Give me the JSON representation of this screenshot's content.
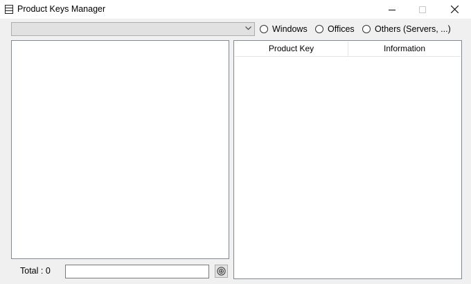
{
  "window": {
    "title": "Product Keys Manager",
    "icons": {
      "app": "list-window-icon",
      "minimize": "minimize-icon",
      "maximize": "maximize-icon",
      "close": "close-icon"
    }
  },
  "filter": {
    "combo_value": "",
    "combo_icon": "chevron-down-icon",
    "radios": [
      {
        "label": "Windows",
        "checked": false
      },
      {
        "label": "Offices",
        "checked": false
      },
      {
        "label": "Others (Servers, ...)",
        "checked": false
      }
    ]
  },
  "table": {
    "columns": [
      "Product Key",
      "Information"
    ],
    "rows": []
  },
  "footer": {
    "total_label": "Total : 0",
    "input_value": "",
    "add_icon": "circle-plus-icon"
  }
}
